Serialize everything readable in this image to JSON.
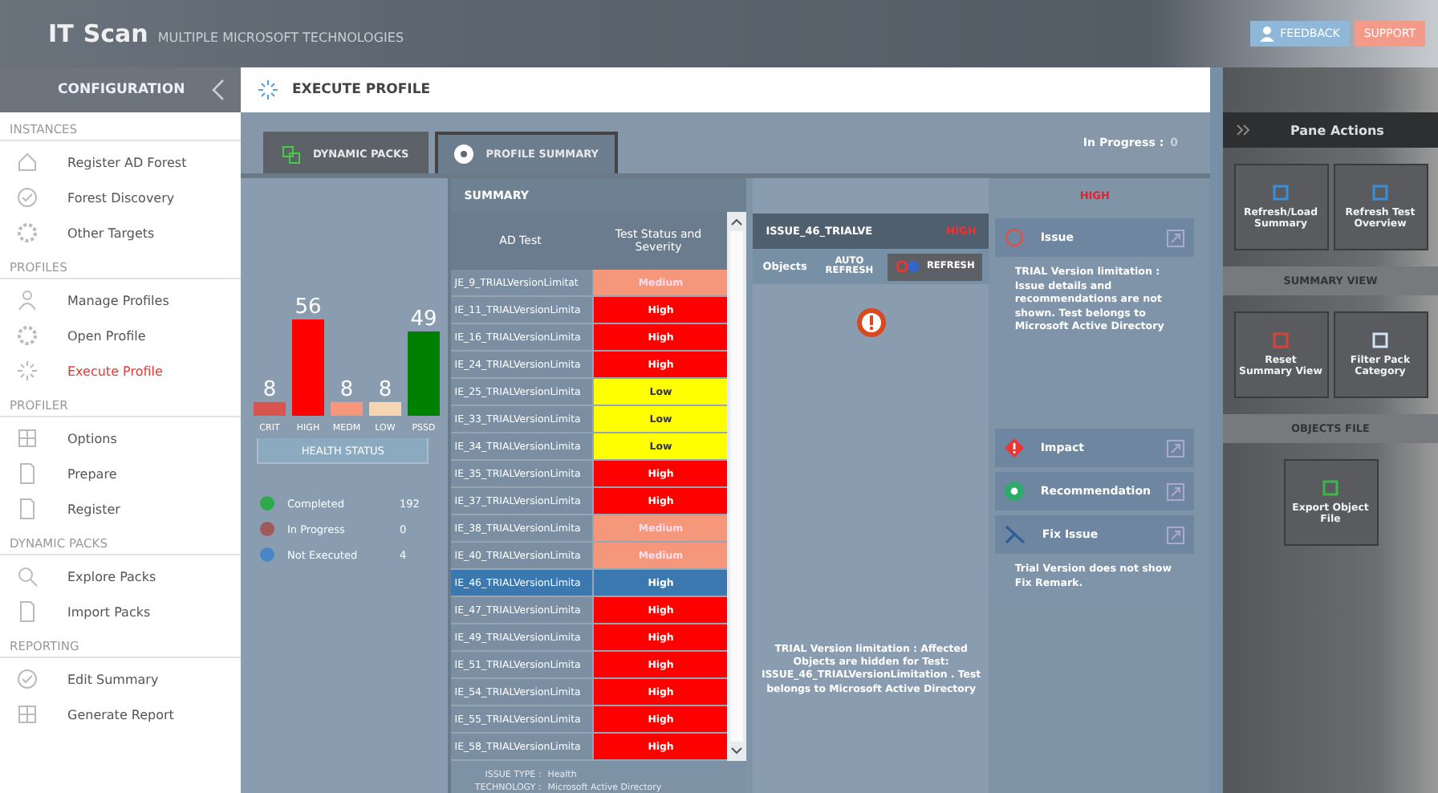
{
  "app": {
    "logo_prefix": "IT",
    "logo_name": "Scan",
    "tagline": "MULTIPLE MICROSOFT TECHNOLOGIES",
    "feedback": "FEEDBACK",
    "support": "SUPPORT"
  },
  "sidebar": {
    "title": "CONFIGURATION",
    "sections": [
      {
        "heading": "INSTANCES",
        "items": [
          {
            "label": "Register AD Forest",
            "selected": false
          },
          {
            "label": "Forest Discovery",
            "selected": false
          },
          {
            "label": "Other Targets",
            "selected": false
          }
        ]
      },
      {
        "heading": "PROFILES",
        "items": [
          {
            "label": "Manage Profiles",
            "selected": false
          },
          {
            "label": "Open Profile",
            "selected": false
          },
          {
            "label": "Execute Profile",
            "selected": true
          }
        ]
      },
      {
        "heading": "PROFILER",
        "items": [
          {
            "label": "Options",
            "selected": false
          },
          {
            "label": "Prepare",
            "selected": false
          },
          {
            "label": "Register",
            "selected": false
          }
        ]
      },
      {
        "heading": "DYNAMIC PACKS",
        "items": [
          {
            "label": "Explore Packs",
            "selected": false
          },
          {
            "label": "Import Packs",
            "selected": false
          }
        ]
      },
      {
        "heading": "REPORTING",
        "items": [
          {
            "label": "Edit Summary",
            "selected": false
          },
          {
            "label": "Generate Report",
            "selected": false
          }
        ]
      }
    ]
  },
  "page_title": "EXECUTE PROFILE",
  "tabs": [
    {
      "label": "DYNAMIC PACKS",
      "selected": false
    },
    {
      "label": "PROFILE SUMMARY",
      "selected": true
    }
  ],
  "in_progress": {
    "label": "In Progress :",
    "value": "0"
  },
  "health": {
    "chart_data": {
      "type": "bar",
      "categories": [
        "CRIT",
        "HIGH",
        "MEDM",
        "LOW",
        "PSSD"
      ],
      "values": [
        8,
        56,
        8,
        8,
        49
      ],
      "data_labels": true
    },
    "button": "HEALTH STATUS",
    "legend": [
      {
        "label": "Completed",
        "value": "192",
        "color": "#2eaa4a"
      },
      {
        "label": "In Progress",
        "value": "0",
        "color": "#a05a5a"
      },
      {
        "label": "Not Executed",
        "value": "4",
        "color": "#4a86c5"
      }
    ]
  },
  "summary": {
    "title": "SUMMARY",
    "columns": [
      "AD Test",
      "Test Status and Severity"
    ],
    "rows": [
      {
        "test": "JE_9_TRIALVersionLimitat",
        "severity": "Medium",
        "kind": "medium",
        "selected": false
      },
      {
        "test": "IE_11_TRIALVersionLimita",
        "severity": "High",
        "kind": "high",
        "selected": false
      },
      {
        "test": "IE_16_TRIALVersionLimita",
        "severity": "High",
        "kind": "high",
        "selected": false
      },
      {
        "test": "IE_24_TRIALVersionLimita",
        "severity": "High",
        "kind": "high",
        "selected": false
      },
      {
        "test": "IE_25_TRIALVersionLimita",
        "severity": "Low",
        "kind": "low",
        "selected": false
      },
      {
        "test": "IE_33_TRIALVersionLimita",
        "severity": "Low",
        "kind": "low",
        "selected": false
      },
      {
        "test": "IE_34_TRIALVersionLimita",
        "severity": "Low",
        "kind": "low",
        "selected": false
      },
      {
        "test": "IE_35_TRIALVersionLimita",
        "severity": "High",
        "kind": "high",
        "selected": false
      },
      {
        "test": "IE_37_TRIALVersionLimita",
        "severity": "High",
        "kind": "high",
        "selected": false
      },
      {
        "test": "IE_38_TRIALVersionLimita",
        "severity": "Medium",
        "kind": "medium",
        "selected": false
      },
      {
        "test": "IE_40_TRIALVersionLimita",
        "severity": "Medium",
        "kind": "medium",
        "selected": false
      },
      {
        "test": "IE_46_TRIALVersionLimita",
        "severity": "High",
        "kind": "high",
        "selected": true
      },
      {
        "test": "IE_47_TRIALVersionLimita",
        "severity": "High",
        "kind": "high",
        "selected": false
      },
      {
        "test": "IE_49_TRIALVersionLimita",
        "severity": "High",
        "kind": "high",
        "selected": false
      },
      {
        "test": "IE_51_TRIALVersionLimita",
        "severity": "High",
        "kind": "high",
        "selected": false
      },
      {
        "test": "IE_54_TRIALVersionLimita",
        "severity": "High",
        "kind": "high",
        "selected": false
      },
      {
        "test": "IE_55_TRIALVersionLimita",
        "severity": "High",
        "kind": "high",
        "selected": false
      },
      {
        "test": "IE_58_TRIALVersionLimita",
        "severity": "High",
        "kind": "high",
        "selected": false
      }
    ],
    "footer": [
      {
        "label": "ISSUE TYPE :",
        "value": "Health"
      },
      {
        "label": "TECHNOLOGY :",
        "value": "Microsoft Active Directory"
      }
    ]
  },
  "objects": {
    "issue_name": "ISSUE_46_TRIALVE",
    "severity": "HIGH",
    "tab": "Objects",
    "auto_refresh": "AUTO REFRESH",
    "refresh": "REFRESH",
    "message": "TRIAL Version limitation : Affected Objects are hidden for Test: ISSUE_46_TRIALVersionLimitation . Test belongs to Microsoft Active Directory"
  },
  "details": {
    "severity": "HIGH",
    "sections": [
      {
        "title": "Issue",
        "kind": "issue",
        "text": "TRIAL Version limitation : Issue details and recommendations are not shown. Test belongs to Microsoft Active Directory"
      },
      {
        "title": "Impact",
        "kind": "impact"
      },
      {
        "title": "Recommendation",
        "kind": "recommendation"
      },
      {
        "title": "Fix Issue",
        "kind": "fix",
        "text": "Trial Version does not show Fix Remark."
      }
    ]
  },
  "pane": {
    "title": "Pane Actions",
    "groups": [
      {
        "buttons": [
          "Refresh/Load Summary",
          "Refresh Test Overview"
        ]
      },
      {
        "heading": "SUMMARY VIEW",
        "buttons": [
          "Reset Summary View",
          "Filter Pack Category"
        ]
      },
      {
        "heading": "OBJECTS FILE",
        "buttons": [
          "Export Object File"
        ]
      }
    ]
  }
}
